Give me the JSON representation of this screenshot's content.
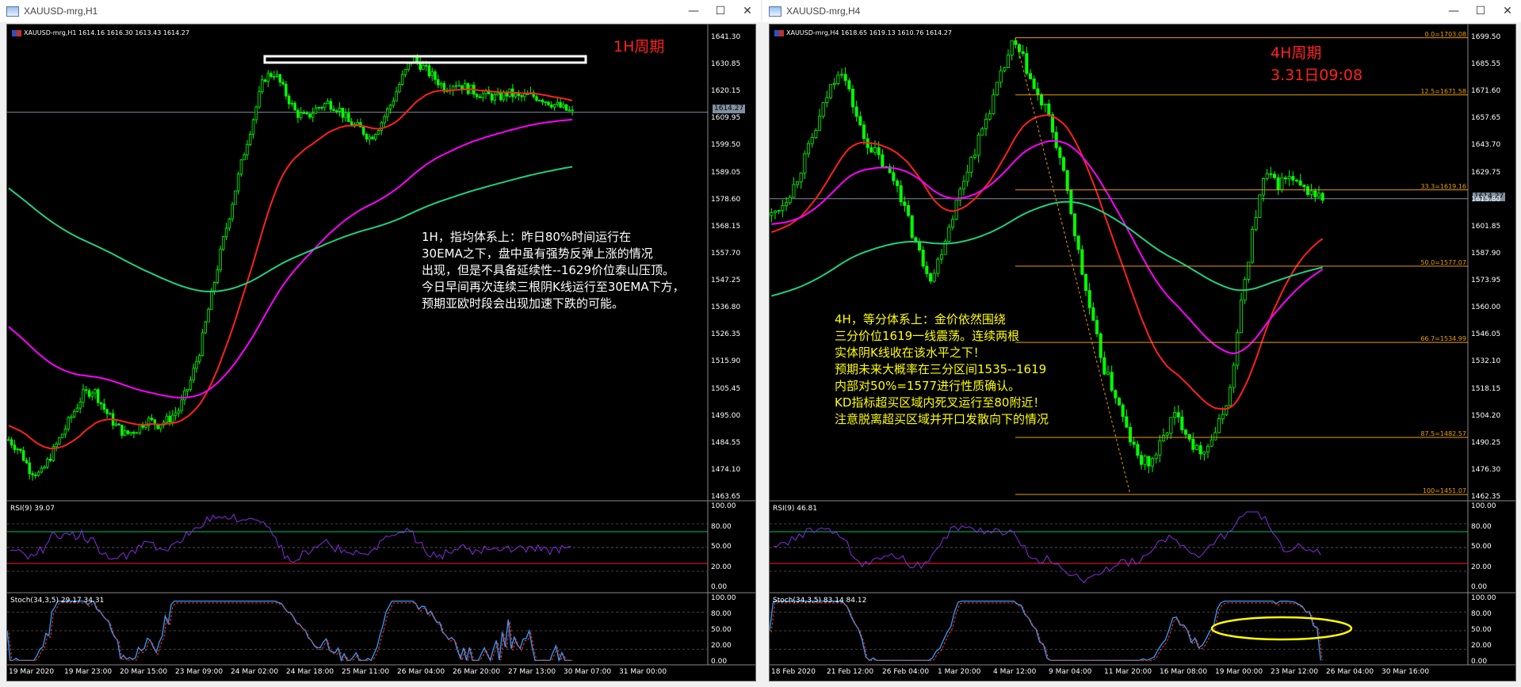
{
  "left": {
    "window_title": "XAUUSD-mrg,H1",
    "header": "XAUUSD-mrg,H1  1614.16 1616.30 1613.43 1614.27",
    "current_price": "1614.27",
    "period_label": "1H周期",
    "price_ticks": [
      "1641.30",
      "1630.85",
      "1620.15",
      "1609.95",
      "1599.50",
      "1589.05",
      "1578.60",
      "1568.15",
      "1557.70",
      "1547.25",
      "1536.80",
      "1526.35",
      "1515.90",
      "1505.45",
      "1495.00",
      "1484.55",
      "1474.10",
      "1463.65"
    ],
    "annotation": [
      "1H，指均体系上：昨日80%时间运行在",
      "30EMA之下，盘中虽有强势反弹上涨的情况",
      "出现，但是不具备延续性--1629价位泰山压顶。",
      "",
      "今日早间再次连续三根阴K线运行至30EMA下方，",
      "预期亚欧时段会出现加速下跌的可能。"
    ],
    "rsi_label": "RSI(9) 39.07",
    "rsi_ticks": [
      "100.00",
      "80.00",
      "50.00",
      "20.00",
      "0.00"
    ],
    "stoch_label": "Stoch(34,3,5) 29.17 34.31",
    "stoch_ticks": [
      "100.00",
      "80.00",
      "50.00",
      "20.00",
      "0.00"
    ],
    "date_ticks": [
      "19 Mar 2020",
      "19 Mar 23:00",
      "20 Mar 15:00",
      "23 Mar 09:00",
      "24 Mar 02:00",
      "24 Mar 18:00",
      "25 Mar 11:00",
      "26 Mar 04:00",
      "26 Mar 20:00",
      "27 Mar 13:00",
      "30 Mar 07:00",
      "31 Mar 00:00"
    ]
  },
  "right": {
    "window_title": "XAUUSD-mrg,H4",
    "header": "XAUUSD-mrg,H4  1618.65 1619.13 1610.76 1614.27",
    "current_price": "1614.27",
    "period_label": "4H周期",
    "period_date": "3.31日09:08",
    "price_ticks": [
      "1699.50",
      "1685.55",
      "1671.60",
      "1657.65",
      "1643.70",
      "1629.75",
      "1615.80",
      "1601.85",
      "1587.90",
      "1573.95",
      "1560.00",
      "1546.05",
      "1532.10",
      "1518.15",
      "1504.20",
      "1490.25",
      "1476.30",
      "1462.35"
    ],
    "fib_levels": [
      "0.0=1703.08",
      "12.5=1671.58",
      "33.3=1619.16",
      "50.0=1577.07",
      "66.7=1534.99",
      "87.5=1482.57",
      "100=1451.07"
    ],
    "annotation": [
      "4H，等分体系上：金价依然围绕",
      "三分价位1619一线震荡。连续两根",
      "实体阴K线收在该水平之下！",
      "",
      "预期未来大概率在三分区间1535--1619",
      "内部对50%=1577进行性质确认。",
      "",
      "KD指标超买区域内死叉运行至80附近！",
      "注意脱离超买区域并开口发散向下的情况"
    ],
    "rsi_label": "RSI(9) 46.81",
    "rsi_ticks": [
      "100.00",
      "80.00",
      "50.00",
      "20.00",
      "0.00"
    ],
    "stoch_label": "Stoch(34,3,5) 83.14 84.12",
    "stoch_ticks": [
      "100.00",
      "80.00",
      "50.00",
      "20.00",
      "0.00"
    ],
    "date_ticks": [
      "18 Feb 2020",
      "21 Feb 12:00",
      "26 Feb 04:00",
      "1 Mar 20:00",
      "4 Mar 12:00",
      "9 Mar 04:00",
      "11 Mar 20:00",
      "16 Mar 08:00",
      "19 Mar 00:00",
      "23 Mar 12:00",
      "26 Mar 04:00",
      "30 Mar 16:00"
    ]
  },
  "controls": {
    "minimize": "—",
    "maximize": "☐",
    "close": "✕"
  },
  "colors": {
    "ema30": "#ff2020",
    "ema_magenta": "#ff00ff",
    "ema_green": "#20d080",
    "candle": "#00ff00",
    "annotation_left": "#ffffff",
    "annotation_right": "#ffff00",
    "fib": "#e8a000",
    "rsi_line": "#8a2be2"
  },
  "chart_data": [
    {
      "type": "candlestick",
      "title": "XAUUSD-mrg,H1",
      "ylim": [
        1460,
        1646
      ],
      "series": [
        {
          "name": "price",
          "values": [
            1484,
            1480,
            1472,
            1470,
            1478,
            1486,
            1494,
            1502,
            1504,
            1496,
            1490,
            1486,
            1488,
            1492,
            1490,
            1492,
            1496,
            1506,
            1520,
            1540,
            1560,
            1578,
            1596,
            1612,
            1628,
            1630,
            1622,
            1614,
            1612,
            1616,
            1618,
            1616,
            1610,
            1608,
            1604,
            1610,
            1618,
            1628,
            1636,
            1632,
            1628,
            1624,
            1626,
            1624,
            1622,
            1621,
            1620,
            1622,
            1620,
            1621,
            1620,
            1618,
            1616,
            1614
          ]
        },
        {
          "name": "EMA30",
          "values": [
            1490,
            1489,
            1487,
            1484,
            1483,
            1483,
            1485,
            1488,
            1490,
            1491,
            1491,
            1491,
            1491,
            1491,
            1491,
            1492,
            1493,
            1497,
            1503,
            1512,
            1524,
            1538,
            1552,
            1566,
            1579,
            1590,
            1598,
            1603,
            1605,
            1607,
            1609,
            1610,
            1610,
            1610,
            1609,
            1609,
            1610,
            1613,
            1617,
            1619,
            1621,
            1622,
            1623,
            1623,
            1623,
            1623,
            1622,
            1622,
            1622,
            1622,
            1621,
            1621,
            1620,
            1619
          ]
        }
      ]
    },
    {
      "type": "candlestick",
      "title": "XAUUSD-mrg,H4",
      "ylim": [
        1448,
        1706
      ],
      "series": [
        {
          "name": "price",
          "values": [
            1605,
            1612,
            1622,
            1638,
            1655,
            1674,
            1688,
            1668,
            1648,
            1640,
            1630,
            1622,
            1600,
            1582,
            1570,
            1590,
            1610,
            1630,
            1646,
            1664,
            1682,
            1700,
            1690,
            1672,
            1662,
            1640,
            1610,
            1575,
            1545,
            1520,
            1505,
            1485,
            1470,
            1468,
            1480,
            1495,
            1488,
            1475,
            1478,
            1490,
            1510,
            1560,
            1600,
            1628,
            1622,
            1626,
            1620,
            1618,
            1614
          ]
        }
      ]
    }
  ]
}
